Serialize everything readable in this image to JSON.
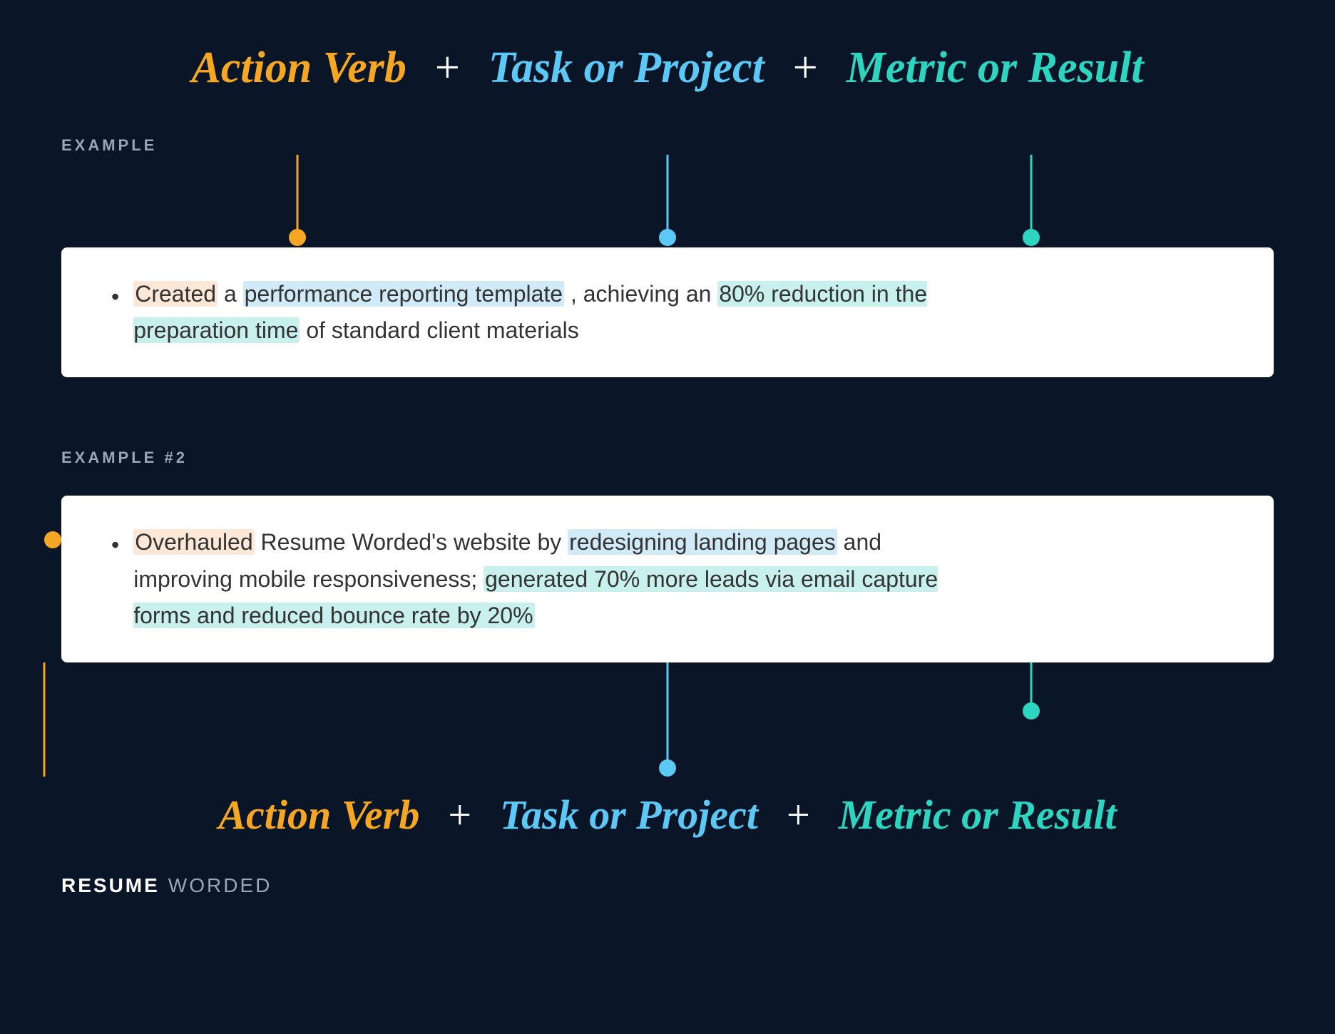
{
  "header": {
    "formula": {
      "term1": "Action Verb",
      "plus1": "+",
      "term2": "Task or Project",
      "plus2": "+",
      "term3": "Metric or Result"
    }
  },
  "example1": {
    "label": "EXAMPLE",
    "text_parts": [
      {
        "text": "Created",
        "highlight": "orange"
      },
      {
        "text": " a ",
        "highlight": "none"
      },
      {
        "text": "performance reporting template",
        "highlight": "blue"
      },
      {
        "text": ", achieving an ",
        "highlight": "none"
      },
      {
        "text": "80% reduction in the preparation time",
        "highlight": "teal"
      },
      {
        "text": " of standard client materials",
        "highlight": "none"
      }
    ]
  },
  "example2": {
    "label": "EXAMPLE #2",
    "text_parts": [
      {
        "text": "Overhauled",
        "highlight": "orange"
      },
      {
        "text": " Resume Worded's website by ",
        "highlight": "none"
      },
      {
        "text": "redesigning landing pages",
        "highlight": "blue"
      },
      {
        "text": " and improving mobile responsiveness; ",
        "highlight": "none"
      },
      {
        "text": "generated 70% more leads via email capture forms and reduced bounce rate by 20%",
        "highlight": "teal"
      }
    ]
  },
  "footer": {
    "formula": {
      "term1": "Action Verb",
      "plus1": "+",
      "term2": "Task or Project",
      "plus2": "+",
      "term3": "Metric or Result"
    },
    "brand_resume": "RESUME",
    "brand_worded": "WORDED"
  },
  "colors": {
    "orange": "#f5a623",
    "blue": "#5bc8f5",
    "teal": "#2dd4bf",
    "bg": "#0a1628",
    "white": "#ffffff",
    "label": "#9aa5b8"
  }
}
